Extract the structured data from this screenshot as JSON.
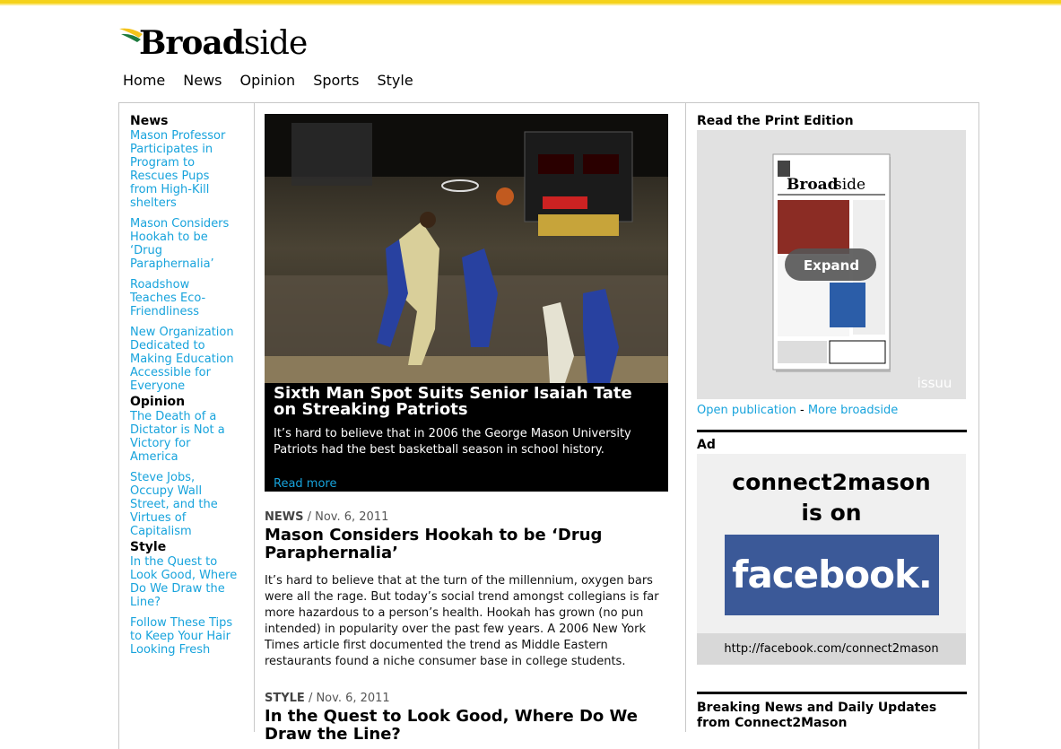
{
  "site": {
    "logo_bold": "Broad",
    "logo_rest": "side"
  },
  "nav": [
    "Home",
    "News",
    "Opinion",
    "Sports",
    "Style"
  ],
  "sidebar": {
    "sections": [
      {
        "title": "News",
        "links": [
          "Mason Professor Participates in Program to Rescues Pups from High-Kill shelters",
          "Mason Considers Hookah to be ‘Drug Paraphernalia’",
          "Roadshow Teaches Eco-Friendliness",
          "New Organization Dedicated to Making Education Accessible for Everyone"
        ]
      },
      {
        "title": "Opinion",
        "links": [
          "The Death of a Dictator is Not a Victory for America",
          "Steve Jobs, Occupy Wall Street, and the Virtues of Capitalism"
        ]
      },
      {
        "title": "Style",
        "links": [
          "In the Quest to Look Good, Where Do We Draw the Line?",
          "Follow These Tips to Keep Your Hair Looking Fresh"
        ]
      }
    ]
  },
  "hero": {
    "title": "Sixth Man Spot Suits Senior Isaiah Tate on Streaking Patriots",
    "text": "It’s hard to believe that in 2006 the George Mason University Patriots had the best basketball season in school history.",
    "read_more": "Read more"
  },
  "articles": [
    {
      "section": "NEWS",
      "date": " / Nov. 6, 2011",
      "title": "Mason Considers Hookah to be ‘Drug Paraphernalia’",
      "text": "It’s hard to believe that at the turn of the millennium, oxygen bars were all the rage. But today’s social trend amongst collegians is far more hazardous to a person’s health. Hookah has grown (no pun intended) in popularity over the past few years. A 2006 New York Times article first documented the trend as Middle Eastern restaurants found a niche consumer base in college students."
    },
    {
      "section": "STYLE",
      "date": " / Nov. 6, 2011",
      "title": "In the Quest to Look Good, Where Do We Draw the Line?"
    }
  ],
  "right": {
    "print_heading": "Read the Print Edition",
    "expand_label": "Expand",
    "issuu_label": "issuu",
    "open_publication": "Open publication",
    "separator": " - ",
    "more_broadside": "More broadside",
    "ad_heading": "Ad",
    "ad_line1": "connect2mason",
    "ad_line2": "is on",
    "ad_facebook": "facebook.",
    "ad_url": "http://facebook.com/connect2mason",
    "breaking_heading": "Breaking News and Daily Updates from Connect2Mason"
  },
  "colors": {
    "link": "#17a3dc",
    "top_bar": "#f5d21a",
    "facebook": "#3b5998"
  }
}
